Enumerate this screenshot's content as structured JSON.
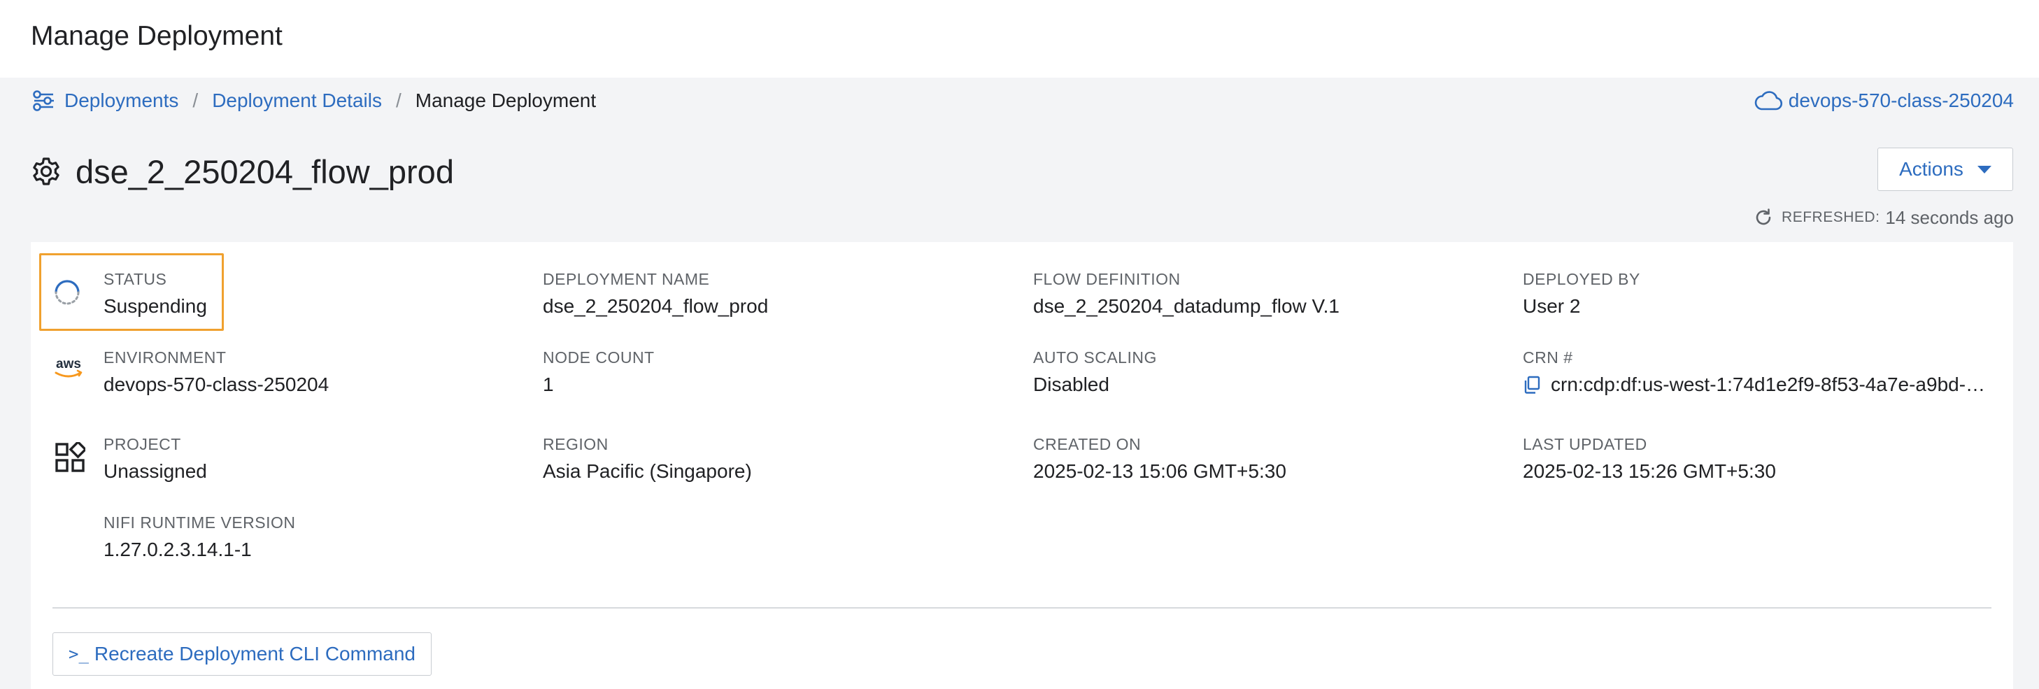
{
  "page": {
    "title": "Manage Deployment"
  },
  "breadcrumb": {
    "items": [
      {
        "label": "Deployments",
        "icon": "deployments-icon"
      },
      {
        "label": "Deployment Details"
      },
      {
        "label": "Manage Deployment"
      }
    ],
    "separator": "/"
  },
  "environment_link": {
    "label": "devops-570-class-250204",
    "icon": "cloud-icon"
  },
  "deployment": {
    "name": "dse_2_250204_flow_prod",
    "icon": "gear-icon"
  },
  "actions": {
    "label": "Actions"
  },
  "refreshed": {
    "label": "REFRESHED:",
    "value": "14 seconds ago"
  },
  "details": {
    "status": {
      "label": "STATUS",
      "value": "Suspending",
      "highlight_color": "#f0a12f"
    },
    "deployment_name": {
      "label": "DEPLOYMENT NAME",
      "value": "dse_2_250204_flow_prod"
    },
    "flow_definition": {
      "label": "FLOW DEFINITION",
      "value": "dse_2_250204_datadump_flow V.1"
    },
    "deployed_by": {
      "label": "DEPLOYED BY",
      "value": "User 2"
    },
    "environment": {
      "label": "ENVIRONMENT",
      "value": "devops-570-class-250204",
      "icon_text": "aws"
    },
    "node_count": {
      "label": "NODE COUNT",
      "value": "1"
    },
    "auto_scaling": {
      "label": "AUTO SCALING",
      "value": "Disabled"
    },
    "crn": {
      "label": "CRN #",
      "value": "crn:cdp:df:us-west-1:74d1e2f9-8f53-4a7e-a9bd-d..."
    },
    "project": {
      "label": "PROJECT",
      "value": "Unassigned"
    },
    "region": {
      "label": "REGION",
      "value": "Asia Pacific (Singapore)"
    },
    "created_on": {
      "label": "CREATED ON",
      "value": "2025-02-13 15:06 GMT+5:30"
    },
    "last_updated": {
      "label": "LAST UPDATED",
      "value": "2025-02-13 15:26 GMT+5:30"
    },
    "nifi_runtime": {
      "label": "NIFI RUNTIME VERSION",
      "value": "1.27.0.2.3.14.1-1"
    }
  },
  "cli_button": {
    "prompt": ">_",
    "label": "Recreate Deployment CLI Command"
  },
  "colors": {
    "link": "#2d6cbf",
    "accent_status": "#f0a12f",
    "aws_orange": "#f7981d"
  }
}
